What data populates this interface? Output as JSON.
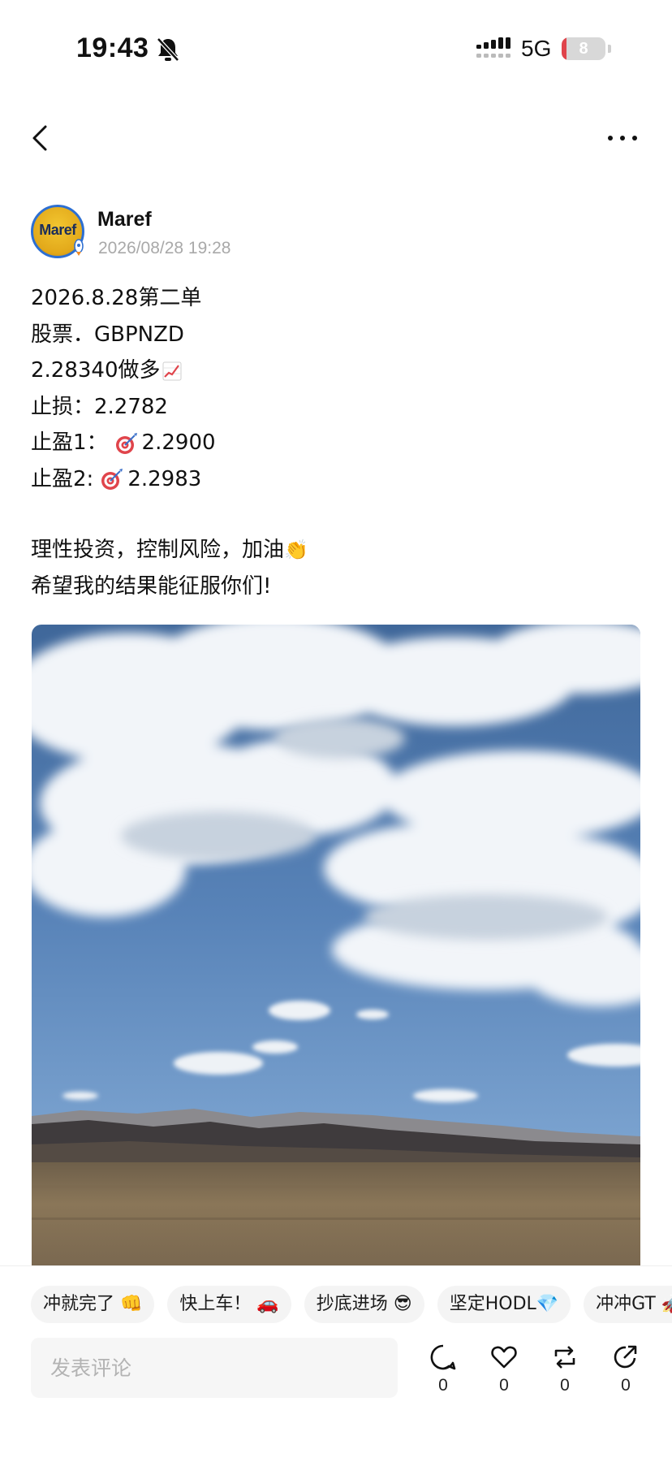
{
  "status_bar": {
    "time": "19:43",
    "network": "5G",
    "battery": "8",
    "battery_level": 0.08,
    "icons": [
      "bell-off-icon",
      "signal-icon",
      "battery-icon"
    ]
  },
  "nav": {
    "icons": [
      "chevron-left-icon",
      "more-dots-icon"
    ]
  },
  "author": {
    "name": "Maref",
    "timestamp": "2026/08/28 19:28",
    "avatar_text": "Maref"
  },
  "post": {
    "line1": "2026.8.28第二单",
    "line2": "股票．GBPNZD",
    "line3": "2.28340做多",
    "line4": "止损：2.2782",
    "line5_label": "止盈1：",
    "line5_value": "2.2900",
    "line6_label": "止盈2:",
    "line6_value": "2.2983",
    "line7": "理性投资，控制风险，加油",
    "line7_emoji": "👏",
    "line8": "希望我的结果能征服你们!"
  },
  "chips": [
    {
      "label": "冲就完了 👊"
    },
    {
      "label": "快上车！ 🚗"
    },
    {
      "label": "抄底进场 😎"
    },
    {
      "label": "坚定HODL💎"
    },
    {
      "label": "冲冲GT 🚀"
    }
  ],
  "comment": {
    "placeholder": "发表评论"
  },
  "actions": {
    "comment_count": "0",
    "like_count": "0",
    "repost_count": "0",
    "share_count": "0"
  },
  "colors": {
    "accent_red": "#e0444b",
    "chip_bg": "#f4f4f4",
    "muted_text": "#a9a9a9"
  }
}
